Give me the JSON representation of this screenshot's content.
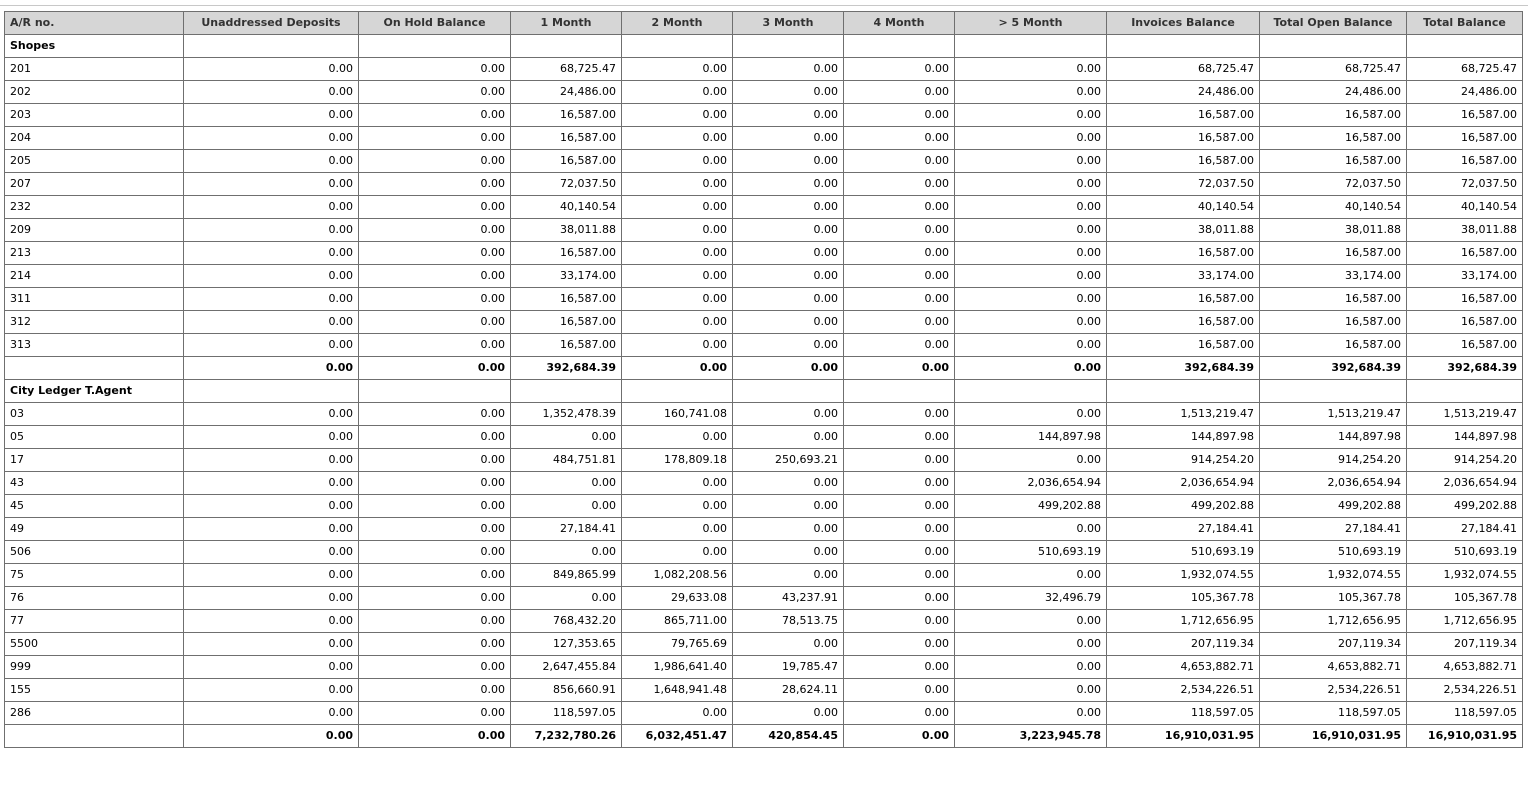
{
  "columns": [
    "A/R no.",
    "Unaddressed Deposits",
    "On Hold Balance",
    "1 Month",
    "2 Month",
    "3 Month",
    "4 Month",
    "> 5 Month",
    "Invoices Balance",
    "Total Open Balance",
    "Total Balance"
  ],
  "groups": [
    {
      "name": "Shopes",
      "rows": [
        [
          "201",
          "0.00",
          "0.00",
          "68,725.47",
          "0.00",
          "0.00",
          "0.00",
          "0.00",
          "68,725.47",
          "68,725.47",
          "68,725.47"
        ],
        [
          "202",
          "0.00",
          "0.00",
          "24,486.00",
          "0.00",
          "0.00",
          "0.00",
          "0.00",
          "24,486.00",
          "24,486.00",
          "24,486.00"
        ],
        [
          "203",
          "0.00",
          "0.00",
          "16,587.00",
          "0.00",
          "0.00",
          "0.00",
          "0.00",
          "16,587.00",
          "16,587.00",
          "16,587.00"
        ],
        [
          "204",
          "0.00",
          "0.00",
          "16,587.00",
          "0.00",
          "0.00",
          "0.00",
          "0.00",
          "16,587.00",
          "16,587.00",
          "16,587.00"
        ],
        [
          "205",
          "0.00",
          "0.00",
          "16,587.00",
          "0.00",
          "0.00",
          "0.00",
          "0.00",
          "16,587.00",
          "16,587.00",
          "16,587.00"
        ],
        [
          "207",
          "0.00",
          "0.00",
          "72,037.50",
          "0.00",
          "0.00",
          "0.00",
          "0.00",
          "72,037.50",
          "72,037.50",
          "72,037.50"
        ],
        [
          "232",
          "0.00",
          "0.00",
          "40,140.54",
          "0.00",
          "0.00",
          "0.00",
          "0.00",
          "40,140.54",
          "40,140.54",
          "40,140.54"
        ],
        [
          "209",
          "0.00",
          "0.00",
          "38,011.88",
          "0.00",
          "0.00",
          "0.00",
          "0.00",
          "38,011.88",
          "38,011.88",
          "38,011.88"
        ],
        [
          "213",
          "0.00",
          "0.00",
          "16,587.00",
          "0.00",
          "0.00",
          "0.00",
          "0.00",
          "16,587.00",
          "16,587.00",
          "16,587.00"
        ],
        [
          "214",
          "0.00",
          "0.00",
          "33,174.00",
          "0.00",
          "0.00",
          "0.00",
          "0.00",
          "33,174.00",
          "33,174.00",
          "33,174.00"
        ],
        [
          "311",
          "0.00",
          "0.00",
          "16,587.00",
          "0.00",
          "0.00",
          "0.00",
          "0.00",
          "16,587.00",
          "16,587.00",
          "16,587.00"
        ],
        [
          "312",
          "0.00",
          "0.00",
          "16,587.00",
          "0.00",
          "0.00",
          "0.00",
          "0.00",
          "16,587.00",
          "16,587.00",
          "16,587.00"
        ],
        [
          "313",
          "0.00",
          "0.00",
          "16,587.00",
          "0.00",
          "0.00",
          "0.00",
          "0.00",
          "16,587.00",
          "16,587.00",
          "16,587.00"
        ]
      ],
      "total": [
        "",
        "0.00",
        "0.00",
        "392,684.39",
        "0.00",
        "0.00",
        "0.00",
        "0.00",
        "392,684.39",
        "392,684.39",
        "392,684.39"
      ]
    },
    {
      "name": "City Ledger T.Agent",
      "rows": [
        [
          "03",
          "0.00",
          "0.00",
          "1,352,478.39",
          "160,741.08",
          "0.00",
          "0.00",
          "0.00",
          "1,513,219.47",
          "1,513,219.47",
          "1,513,219.47"
        ],
        [
          "05",
          "0.00",
          "0.00",
          "0.00",
          "0.00",
          "0.00",
          "0.00",
          "144,897.98",
          "144,897.98",
          "144,897.98",
          "144,897.98"
        ],
        [
          "17",
          "0.00",
          "0.00",
          "484,751.81",
          "178,809.18",
          "250,693.21",
          "0.00",
          "0.00",
          "914,254.20",
          "914,254.20",
          "914,254.20"
        ],
        [
          "43",
          "0.00",
          "0.00",
          "0.00",
          "0.00",
          "0.00",
          "0.00",
          "2,036,654.94",
          "2,036,654.94",
          "2,036,654.94",
          "2,036,654.94"
        ],
        [
          "45",
          "0.00",
          "0.00",
          "0.00",
          "0.00",
          "0.00",
          "0.00",
          "499,202.88",
          "499,202.88",
          "499,202.88",
          "499,202.88"
        ],
        [
          "49",
          "0.00",
          "0.00",
          "27,184.41",
          "0.00",
          "0.00",
          "0.00",
          "0.00",
          "27,184.41",
          "27,184.41",
          "27,184.41"
        ],
        [
          "506",
          "0.00",
          "0.00",
          "0.00",
          "0.00",
          "0.00",
          "0.00",
          "510,693.19",
          "510,693.19",
          "510,693.19",
          "510,693.19"
        ],
        [
          "75",
          "0.00",
          "0.00",
          "849,865.99",
          "1,082,208.56",
          "0.00",
          "0.00",
          "0.00",
          "1,932,074.55",
          "1,932,074.55",
          "1,932,074.55"
        ],
        [
          "76",
          "0.00",
          "0.00",
          "0.00",
          "29,633.08",
          "43,237.91",
          "0.00",
          "32,496.79",
          "105,367.78",
          "105,367.78",
          "105,367.78"
        ],
        [
          "77",
          "0.00",
          "0.00",
          "768,432.20",
          "865,711.00",
          "78,513.75",
          "0.00",
          "0.00",
          "1,712,656.95",
          "1,712,656.95",
          "1,712,656.95"
        ],
        [
          "5500",
          "0.00",
          "0.00",
          "127,353.65",
          "79,765.69",
          "0.00",
          "0.00",
          "0.00",
          "207,119.34",
          "207,119.34",
          "207,119.34"
        ],
        [
          "999",
          "0.00",
          "0.00",
          "2,647,455.84",
          "1,986,641.40",
          "19,785.47",
          "0.00",
          "0.00",
          "4,653,882.71",
          "4,653,882.71",
          "4,653,882.71"
        ],
        [
          "155",
          "0.00",
          "0.00",
          "856,660.91",
          "1,648,941.48",
          "28,624.11",
          "0.00",
          "0.00",
          "2,534,226.51",
          "2,534,226.51",
          "2,534,226.51"
        ],
        [
          "286",
          "0.00",
          "0.00",
          "118,597.05",
          "0.00",
          "0.00",
          "0.00",
          "0.00",
          "118,597.05",
          "118,597.05",
          "118,597.05"
        ]
      ],
      "total": [
        "",
        "0.00",
        "0.00",
        "7,232,780.26",
        "6,032,451.47",
        "420,854.45",
        "0.00",
        "3,223,945.78",
        "16,910,031.95",
        "16,910,031.95",
        "16,910,031.95"
      ]
    }
  ]
}
